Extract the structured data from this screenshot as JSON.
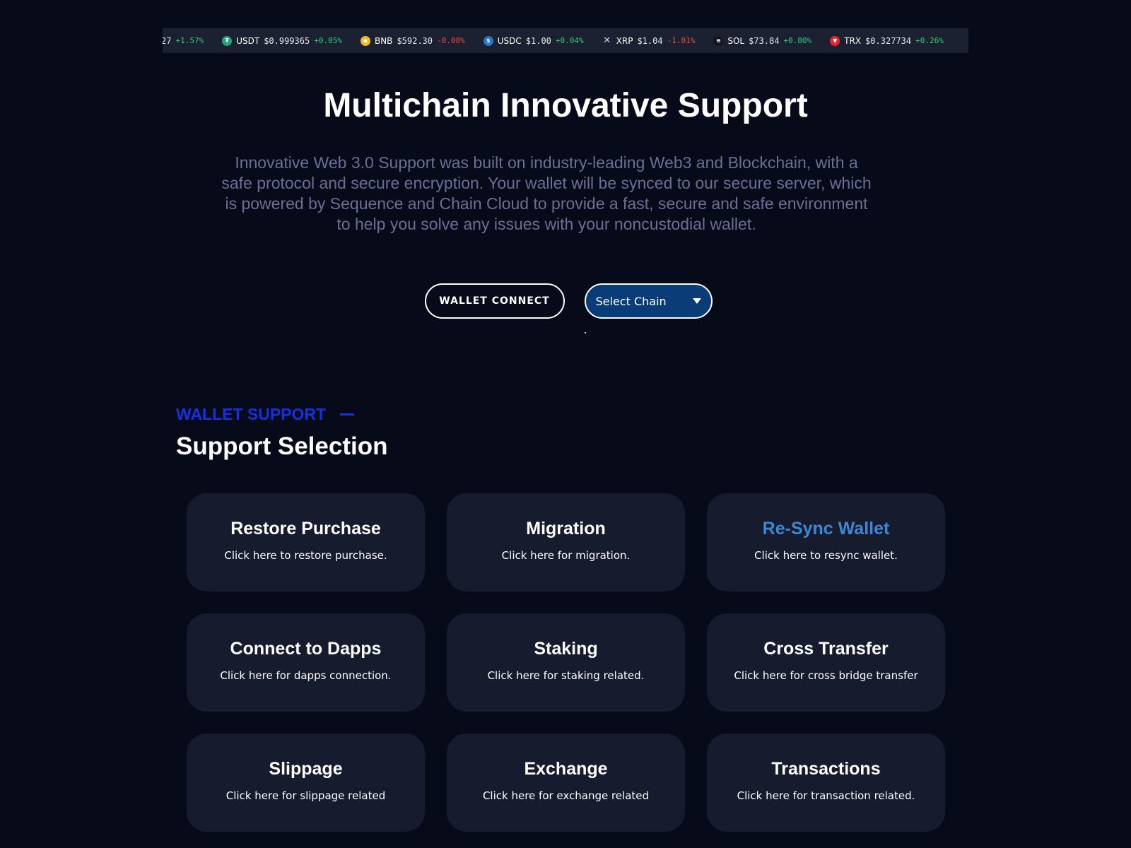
{
  "ticker": [
    {
      "symbol": "",
      "price": "27",
      "change": "+1.57%",
      "direction": "up",
      "icon": "none",
      "icon_color": ""
    },
    {
      "symbol": "USDT",
      "price": "$0.999365",
      "change": "+0.05%",
      "direction": "up",
      "icon": "tether-icon",
      "icon_color": "#26a17b",
      "glyph": "₮"
    },
    {
      "symbol": "BNB",
      "price": "$592.30",
      "change": "-0.08%",
      "direction": "down",
      "icon": "bnb-icon",
      "icon_color": "#f3ba2f",
      "glyph": "◆"
    },
    {
      "symbol": "USDC",
      "price": "$1.00",
      "change": "+0.04%",
      "direction": "up",
      "icon": "usdc-icon",
      "icon_color": "#2775ca",
      "glyph": "$"
    },
    {
      "symbol": "XRP",
      "price": "$1.04",
      "change": "-1.01%",
      "direction": "down",
      "icon": "xrp-icon",
      "icon_color": "",
      "glyph": "✕"
    },
    {
      "symbol": "SOL",
      "price": "$73.84",
      "change": "+0.80%",
      "direction": "up",
      "icon": "solana-icon",
      "icon_color": "#14151c",
      "glyph": "≡"
    },
    {
      "symbol": "TRX",
      "price": "$0.327734",
      "change": "+0.26%",
      "direction": "up",
      "icon": "tron-icon",
      "icon_color": "#e5272d",
      "glyph": "▼"
    }
  ],
  "hero": {
    "title": "Multichain Innovative Support",
    "description": "Innovative Web 3.0 Support was built on industry-leading Web3 and Blockchain, with a safe protocol and secure encryption. Your wallet will be synced to our secure server, which is powered by Sequence and Chain Cloud to provide a fast, secure and safe environment to help you solve any issues with your noncustodial wallet."
  },
  "actions": {
    "wallet_connect_label": "WALLET CONNECT",
    "select_chain_value": "Select Chain"
  },
  "support": {
    "eyebrow": "WALLET SUPPORT",
    "title": "Support Selection",
    "cards": [
      {
        "title": "Restore Purchase",
        "desc": "Click here to restore purchase.",
        "active": false
      },
      {
        "title": "Migration",
        "desc": "Click here for migration.",
        "active": false
      },
      {
        "title": "Re-Sync Wallet",
        "desc": "Click here to resync wallet.",
        "active": true
      },
      {
        "title": "Connect to Dapps",
        "desc": "Click here for dapps connection.",
        "active": false
      },
      {
        "title": "Staking",
        "desc": "Click here for staking related.",
        "active": false
      },
      {
        "title": "Cross Transfer",
        "desc": "Click here for cross bridge transfer",
        "active": false
      },
      {
        "title": "Slippage",
        "desc": "Click here for slippage related",
        "active": false
      },
      {
        "title": "Exchange",
        "desc": "Click here for exchange related",
        "active": false
      },
      {
        "title": "Transactions",
        "desc": "Click here for transaction related.",
        "active": false
      }
    ]
  },
  "colors": {
    "background": "#070a19",
    "card": "#171b2e",
    "accent_blue": "#1531e3",
    "active_title": "#3f86d4",
    "select_bg": "#0a3d78",
    "up": "#2fcf78",
    "down": "#ee4b4b"
  }
}
